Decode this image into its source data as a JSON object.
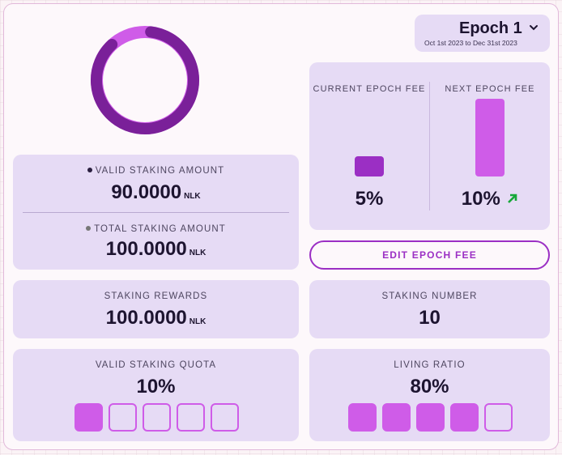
{
  "epoch": {
    "title": "Epoch 1",
    "range": "Oct 1st 2023 to Dec 31st 2023"
  },
  "donut": {
    "valid_fraction": 0.9
  },
  "staking": {
    "valid_label": "VALID STAKING AMOUNT",
    "valid_value": "90.0000",
    "total_label": "TOTAL STAKING AMOUNT",
    "total_value": "100.0000",
    "unit": "NLK"
  },
  "fees": {
    "current_label": "CURRENT EPOCH FEE",
    "current_value": "5%",
    "next_label": "NEXT EPOCH FEE",
    "next_value": "10%",
    "edit_label": "EDIT EPOCH FEE"
  },
  "rewards": {
    "label": "STAKING REWARDS",
    "value": "100.0000",
    "unit": "NLK"
  },
  "number": {
    "label": "STAKING NUMBER",
    "value": "10"
  },
  "quota": {
    "label": "VALID STAKING QUOTA",
    "value": "10%",
    "filled": 1,
    "total": 5
  },
  "living": {
    "label": "LIVING RATIO",
    "value": "80%",
    "filled": 4,
    "total": 5
  },
  "colors": {
    "accent_dark": "#7a2099",
    "accent_light": "#cf5ce8",
    "current_bar": "#9b2fc4",
    "next_bar": "#cf5ce8",
    "arrow_up": "#18a83a"
  }
}
